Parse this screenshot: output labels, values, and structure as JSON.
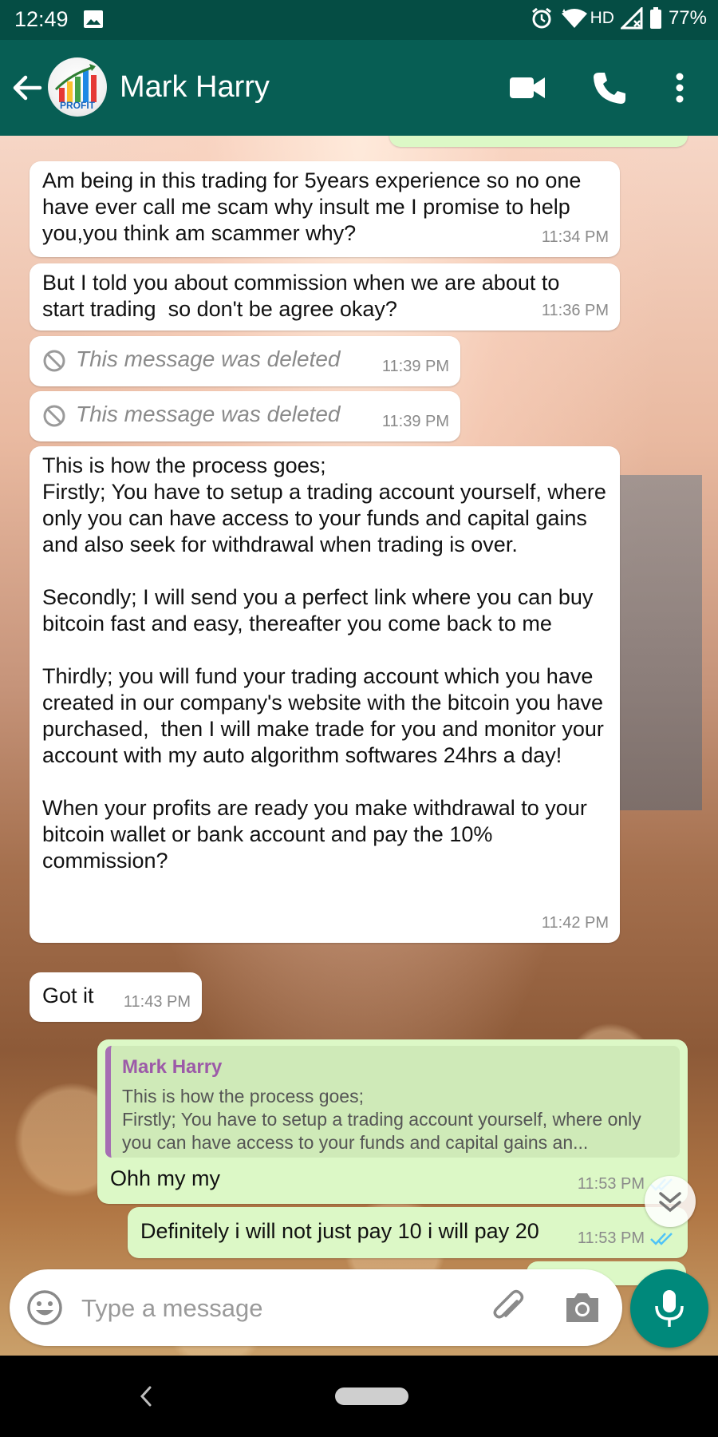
{
  "status_bar": {
    "time": "12:49",
    "network": "HD",
    "battery": "77%"
  },
  "header": {
    "contact_name": "Mark Harry",
    "avatar_text": "PROFIT"
  },
  "messages": [
    {
      "direction": "in",
      "text": "Am being in this trading for 5years experience so no one have ever call me scam why insult me I promise to help you,you think am scammer why?",
      "time": "11:34 PM"
    },
    {
      "direction": "in",
      "text": "But I told you about commission when we are about to start trading  so don't be agree okay?",
      "time": "11:36 PM"
    },
    {
      "direction": "in",
      "deleted": true,
      "text": "This message was deleted",
      "time": "11:39 PM"
    },
    {
      "direction": "in",
      "deleted": true,
      "text": "This message was deleted",
      "time": "11:39 PM"
    },
    {
      "direction": "in",
      "text": "This is how the process goes;\nFirstly; You have to setup a trading account yourself, where only you can have access to your funds and capital gains and also seek for withdrawal when trading is over.\n\nSecondly; I will send you a perfect link where you can buy bitcoin fast and easy, thereafter you come back to me\n\nThirdly; you will fund your trading account which you have created in our company's website with the bitcoin you have purchased,  then I will make trade for you and monitor your account with my auto algorithm softwares 24hrs a day!\n\nWhen your profits are ready you make withdrawal to your bitcoin wallet or bank account and pay the 10% commission?",
      "time": "11:42 PM"
    },
    {
      "direction": "in",
      "text": "Got it",
      "time": "11:43 PM"
    },
    {
      "direction": "out",
      "quote_name": "Mark Harry",
      "quote_text": "This is how the process goes;\nFirstly; You have to setup a trading account yourself, where only you can have access to your funds and capital gains an...",
      "text": "Ohh my my",
      "time": "11:53 PM",
      "status": "read"
    },
    {
      "direction": "out",
      "text": "Definitely i will not just pay 10 i will pay 20",
      "time": "11:53 PM",
      "status": "read"
    }
  ],
  "composer": {
    "placeholder": "Type a message"
  },
  "icons": {
    "back": "arrow-left-icon",
    "video": "video-camera-icon",
    "call": "phone-icon",
    "menu": "more-vert-icon",
    "emoji": "emoji-icon",
    "attach": "paperclip-icon",
    "camera": "camera-icon",
    "mic": "microphone-icon",
    "deleted": "block-icon",
    "scroll": "double-chevron-down-icon"
  },
  "colors": {
    "header": "#075e54",
    "status_bar": "#054d44",
    "outgoing_bubble": "#dcf8c6",
    "incoming_bubble": "#ffffff",
    "mic_button": "#00897b",
    "read_ticks": "#4fc3f7",
    "quote_bar": "#a66fb3"
  }
}
